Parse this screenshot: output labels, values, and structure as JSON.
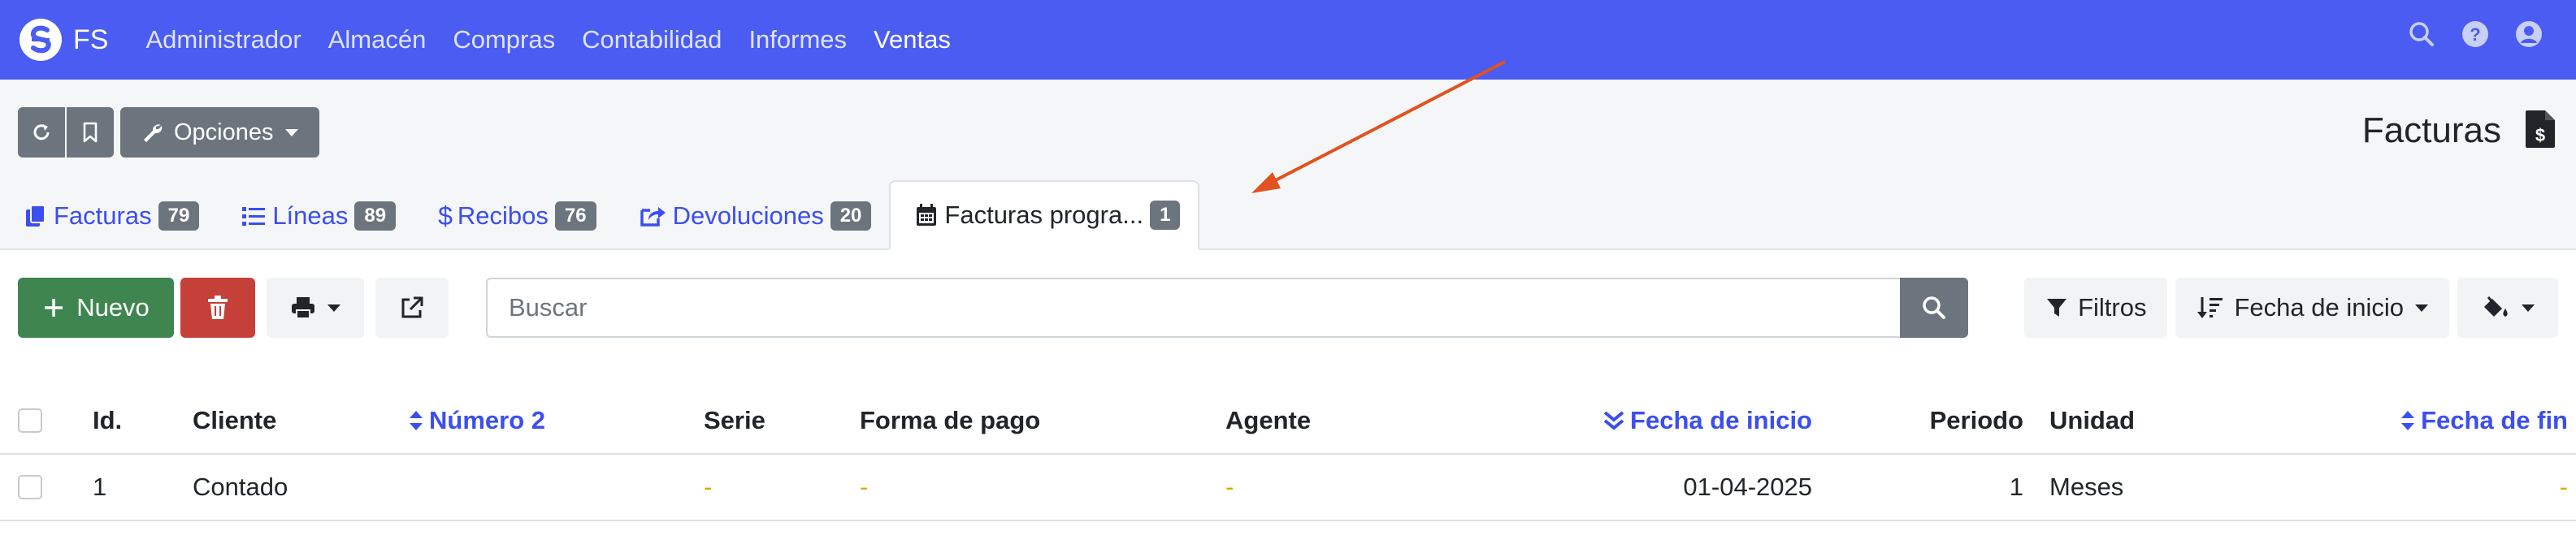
{
  "navbar": {
    "brand": "FS",
    "menu": [
      "Administrador",
      "Almacén",
      "Compras",
      "Contabilidad",
      "Informes",
      "Ventas"
    ],
    "active": "Ventas",
    "icons": [
      "search-icon",
      "help-icon",
      "user-icon"
    ]
  },
  "toolbar": {
    "options_label": "Opciones"
  },
  "page": {
    "title": "Facturas"
  },
  "tabs": [
    {
      "label": "Facturas",
      "badge": "79",
      "icon": "copy-icon"
    },
    {
      "label": "Líneas",
      "badge": "89",
      "icon": "list-icon"
    },
    {
      "label": "Recibos",
      "badge": "76",
      "icon": "dollar-icon"
    },
    {
      "label": "Devoluciones",
      "badge": "20",
      "icon": "share-icon"
    },
    {
      "label": "Facturas progra...",
      "badge": "1",
      "icon": "calendar-icon",
      "active": true
    }
  ],
  "actions": {
    "new_label": "Nuevo"
  },
  "search": {
    "placeholder": "Buscar",
    "value": ""
  },
  "filters": {
    "filter_label": "Filtros",
    "order_label": "Fecha de inicio"
  },
  "table": {
    "columns": [
      "Id.",
      "Cliente",
      "Número 2",
      "Serie",
      "Forma de pago",
      "Agente",
      "Fecha de inicio",
      "Periodo",
      "Unidad",
      "Fecha de fin"
    ],
    "rows": [
      {
        "id": "1",
        "cliente": "Contado",
        "numero2": "",
        "serie": "-",
        "forma_pago": "-",
        "agente": "-",
        "fecha_inicio": "01-04-2025",
        "periodo": "1",
        "unidad": "Meses",
        "fecha_fin": "-"
      }
    ]
  },
  "colors": {
    "navbar": "#4a5cf2",
    "accent": "#3b4ef0",
    "success": "#3f8550",
    "danger": "#c6403a",
    "secondary": "#6c757d",
    "arrow": "#e0531f"
  }
}
